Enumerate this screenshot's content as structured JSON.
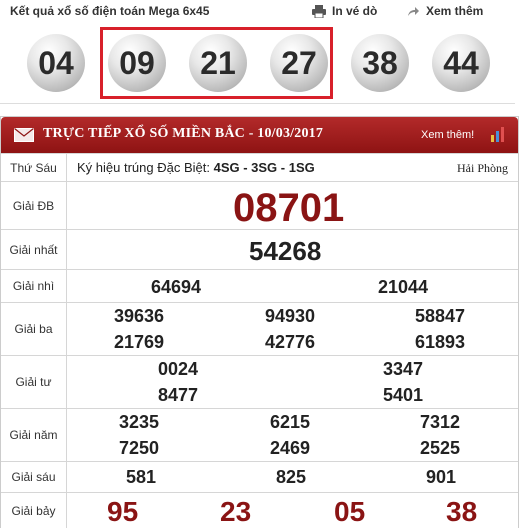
{
  "mega": {
    "title": "Kết quả xổ số điện toán Mega 6x45",
    "print_label": "In vé dò",
    "more_label": "Xem thêm",
    "balls": [
      "04",
      "09",
      "21",
      "27",
      "38",
      "44"
    ]
  },
  "result": {
    "title": "TRỰC TIẾP XỔ SỐ MIỀN BẮC - 10/03/2017",
    "more_label": "Xem thêm!",
    "day": "Thứ Sáu",
    "special_code_label": "Ký hiệu trúng Đặc Biệt:",
    "special_codes": "4SG - 3SG - 1SG",
    "province": "Hải Phòng",
    "prizes": {
      "db": {
        "label": "Giải ĐB",
        "numbers": [
          "08701"
        ]
      },
      "nhat": {
        "label": "Giải nhất",
        "numbers": [
          "54268"
        ]
      },
      "nhi": {
        "label": "Giải nhì",
        "numbers": [
          "64694",
          "21044"
        ]
      },
      "ba": {
        "label": "Giải ba",
        "numbers": [
          "39636",
          "94930",
          "58847",
          "21769",
          "42776",
          "61893"
        ]
      },
      "tu": {
        "label": "Giải tư",
        "numbers": [
          "0024",
          "3347",
          "8477",
          "5401"
        ]
      },
      "nam": {
        "label": "Giải năm",
        "numbers": [
          "3235",
          "6215",
          "7312",
          "7250",
          "2469",
          "2525"
        ]
      },
      "sau": {
        "label": "Giải sáu",
        "numbers": [
          "581",
          "825",
          "901"
        ]
      },
      "bay": {
        "label": "Giải bảy",
        "numbers": [
          "95",
          "23",
          "05",
          "38"
        ]
      }
    }
  },
  "colors": {
    "title_bar": "#9e1b1b",
    "highlight": "#d8202a",
    "special_number": "#8a1414"
  }
}
